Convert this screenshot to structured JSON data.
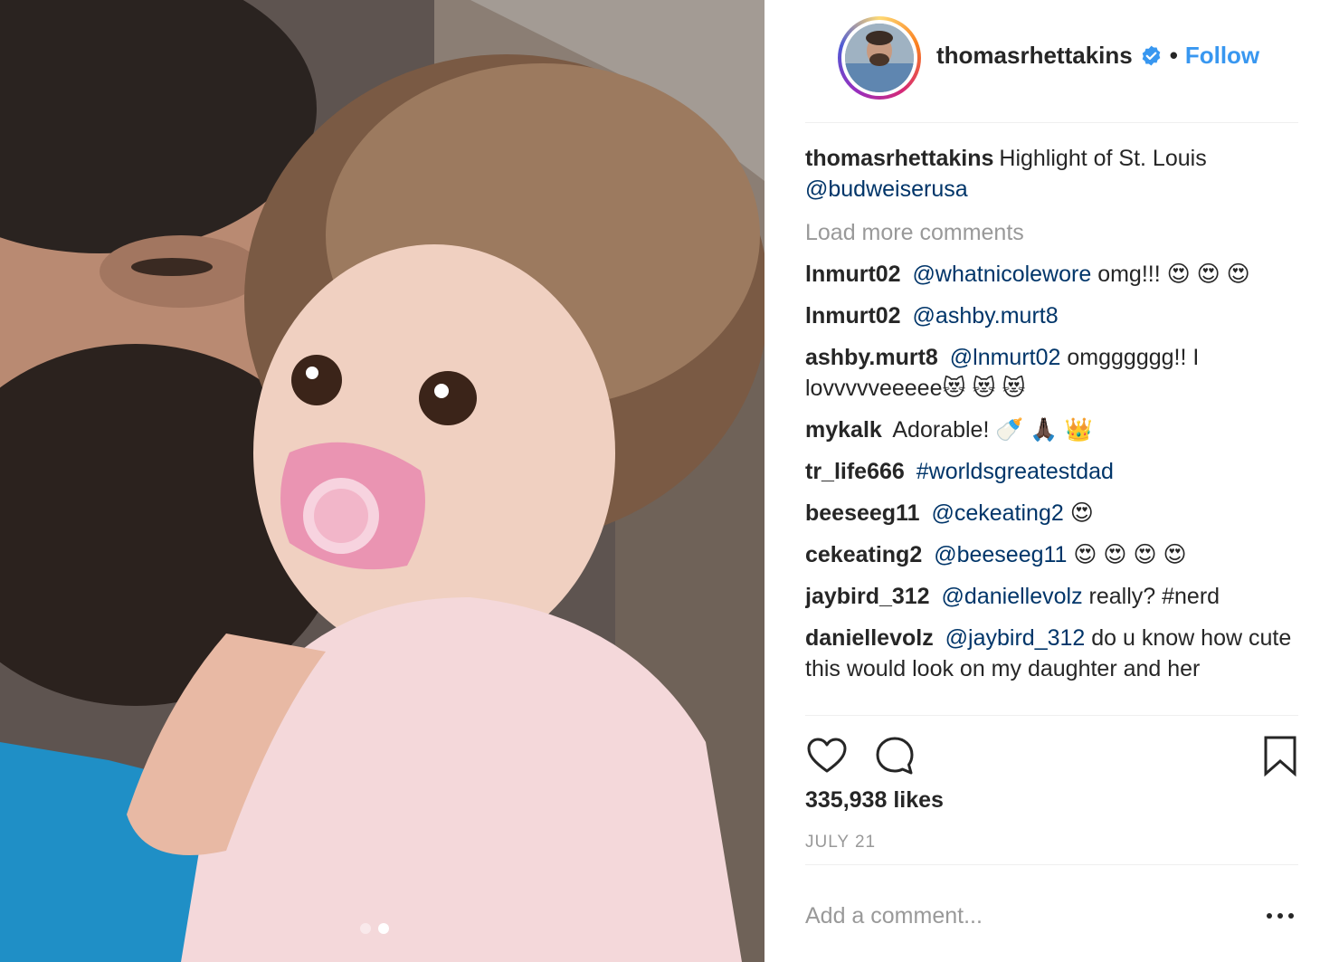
{
  "post": {
    "photo_alt": "Bearded man kissing toddler with pink pacifier",
    "carousel_count": 2,
    "carousel_active": 2
  },
  "header": {
    "username": "thomasrhettakins",
    "verified": true,
    "separator": "•",
    "follow_label": "Follow"
  },
  "caption": {
    "username": "thomasrhettakins",
    "text": "Highlight of St. Louis",
    "mention": "@budweiserusa"
  },
  "load_more_label": "Load more comments",
  "comments": [
    {
      "user": "lnmurt02",
      "mention": "@whatnicolewore",
      "text": "omg!!! 😍 😍 😍"
    },
    {
      "user": "lnmurt02",
      "mention": "@ashby.murt8",
      "text": ""
    },
    {
      "user": "ashby.murt8",
      "mention": "@lnmurt02",
      "text": "omgggggg!! I lovvvvveeeee😻 😻 😻"
    },
    {
      "user": "mykalk",
      "mention": "",
      "text": "Adorable! 🍼 🙏🏿 👑"
    },
    {
      "user": "tr_life666",
      "mention": "#worldsgreatestdad",
      "text": ""
    },
    {
      "user": "beeseeg11",
      "mention": "@cekeating2",
      "text": "😍"
    },
    {
      "user": "cekeating2",
      "mention": "@beeseeg11",
      "text": "😍 😍 😍 😍"
    },
    {
      "user": "jaybird_312",
      "mention": "@daniellevolz",
      "text": "really? #nerd"
    },
    {
      "user": "daniellevolz",
      "mention": "@jaybird_312",
      "text": "do u know how cute this would look on my daughter and her"
    }
  ],
  "actions": {
    "like_icon": "heart-icon",
    "comment_icon": "comment-bubble-icon",
    "save_icon": "bookmark-icon"
  },
  "likes_label": "335,938 likes",
  "date_label": "JULY 21",
  "add_comment": {
    "placeholder": "Add a comment...",
    "more_icon": "more-options-icon"
  },
  "colors": {
    "link_blue": "#3897f0",
    "mention_navy": "#003569",
    "muted_gray": "#999999",
    "verified_blue": "#3897f0"
  }
}
